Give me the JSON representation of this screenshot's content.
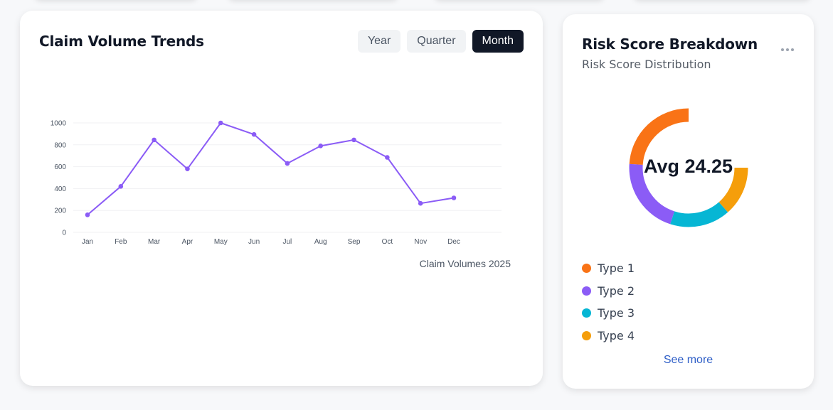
{
  "claim_trends": {
    "title": "Claim Volume Trends",
    "periods": [
      {
        "label": "Year",
        "active": false
      },
      {
        "label": "Quarter",
        "active": false
      },
      {
        "label": "Month",
        "active": true
      }
    ],
    "caption": "Claim Volumes 2025"
  },
  "risk": {
    "title": "Risk Score Breakdown",
    "subtitle": "Risk Score Distribution",
    "center_label": "Avg 24.25",
    "legend": [
      {
        "label": "Type 1",
        "color": "#f97316"
      },
      {
        "label": "Type 2",
        "color": "#8b5cf6"
      },
      {
        "label": "Type 3",
        "color": "#06b6d4"
      },
      {
        "label": "Type 4",
        "color": "#f59e0b"
      }
    ],
    "see_more": "See more"
  },
  "chart_data": [
    {
      "type": "line",
      "title": "",
      "xlabel": "",
      "ylabel": "",
      "categories": [
        "Jan",
        "Feb",
        "Mar",
        "Apr",
        "May",
        "Jun",
        "Jul",
        "Aug",
        "Sep",
        "Oct",
        "Nov",
        "Dec"
      ],
      "values": [
        160,
        420,
        845,
        580,
        1000,
        895,
        630,
        790,
        845,
        685,
        265,
        315
      ],
      "ylim": [
        0,
        1000
      ],
      "yticks": [
        0,
        200,
        400,
        600,
        800,
        1000
      ],
      "color": "#8b5cf6",
      "grid": true
    },
    {
      "type": "pie",
      "title": "",
      "style": "donut",
      "slices": [
        {
          "label": "Type 1",
          "value": 32,
          "color": "#f97316"
        },
        {
          "label": "Type 2",
          "value": 28,
          "color": "#8b5cf6"
        },
        {
          "label": "Type 3",
          "value": 22,
          "color": "#06b6d4"
        },
        {
          "label": "Type 4",
          "value": 18,
          "color": "#f59e0b"
        }
      ],
      "visible_fraction": 0.75
    }
  ]
}
